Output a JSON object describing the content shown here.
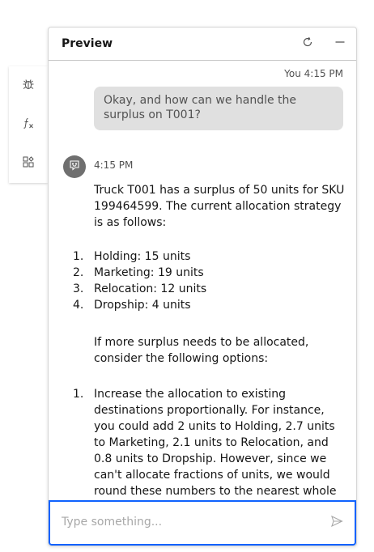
{
  "side_toolbar": {
    "items": [
      {
        "icon": "bug-icon"
      },
      {
        "icon": "function-icon"
      },
      {
        "icon": "components-icon"
      }
    ]
  },
  "panel": {
    "title": "Preview",
    "refresh_icon": "refresh-icon",
    "minimize_icon": "minimize-icon"
  },
  "messages": {
    "user": {
      "meta": "You 4:15 PM",
      "text": "Okay, and how can we handle the surplus on T001?"
    },
    "bot": {
      "time": "4:15 PM",
      "intro": "Truck T001 has a surplus of 50 units for SKU 199464599. The current allocation strategy is as follows:",
      "allocation_list": [
        {
          "num": "1.",
          "text": "Holding: 15 units"
        },
        {
          "num": "2.",
          "text": "Marketing: 19 units"
        },
        {
          "num": "3.",
          "text": "Relocation: 12 units"
        },
        {
          "num": "4.",
          "text": "Dropship: 4 units"
        }
      ],
      "followup": "If more surplus needs to be allocated, consider the following options:",
      "options_list": [
        {
          "num": "1.",
          "text": "Increase the allocation to existing destinations proportionally. For instance, you could add 2 units to Holding, 2.7 units to Marketing, 2.1 units to Relocation, and 0.8 units to Dropship. However, since we can't allocate fractions of units, we would round these numbers to the nearest whole number."
        }
      ]
    }
  },
  "input": {
    "placeholder": "Type something...",
    "value": "",
    "send_icon": "send-icon"
  },
  "colors": {
    "accent": "#0f62fe",
    "user_bubble": "#e0e0e0",
    "avatar": "#6f6f6f"
  }
}
